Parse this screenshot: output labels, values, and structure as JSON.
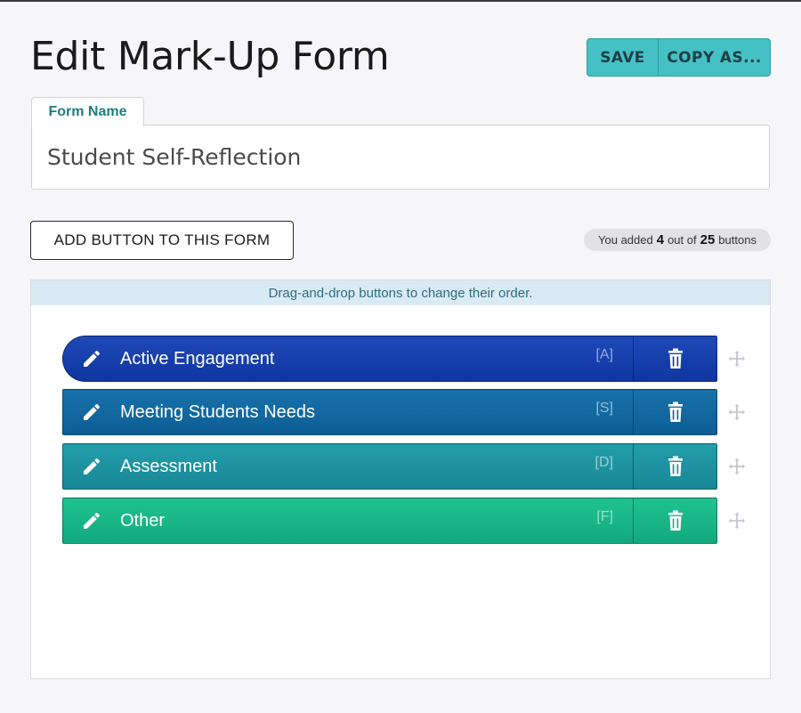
{
  "header": {
    "title": "Edit Mark-Up Form",
    "save_label": "SAVE",
    "copy_label": "COPY AS..."
  },
  "form_name": {
    "tab_label": "Form Name",
    "value": "Student Self-Reflection"
  },
  "add_button_label": "ADD BUTTON TO THIS FORM",
  "counter": {
    "prefix": "You added",
    "added": "4",
    "middle": "out of",
    "total": "25",
    "suffix": "buttons"
  },
  "hint": "Drag-and-drop buttons to change their order.",
  "buttons": [
    {
      "label": "Active Engagement",
      "key": "[A]",
      "color": "#1544ac"
    },
    {
      "label": "Meeting Students Needs",
      "key": "[S]",
      "color": "#1267a0"
    },
    {
      "label": "Assessment",
      "key": "[D]",
      "color": "#1d93a1"
    },
    {
      "label": "Other",
      "key": "[F]",
      "color": "#18b787"
    }
  ],
  "icons": {
    "edit": "pencil-icon",
    "delete": "trash-icon",
    "drag": "move-icon"
  }
}
